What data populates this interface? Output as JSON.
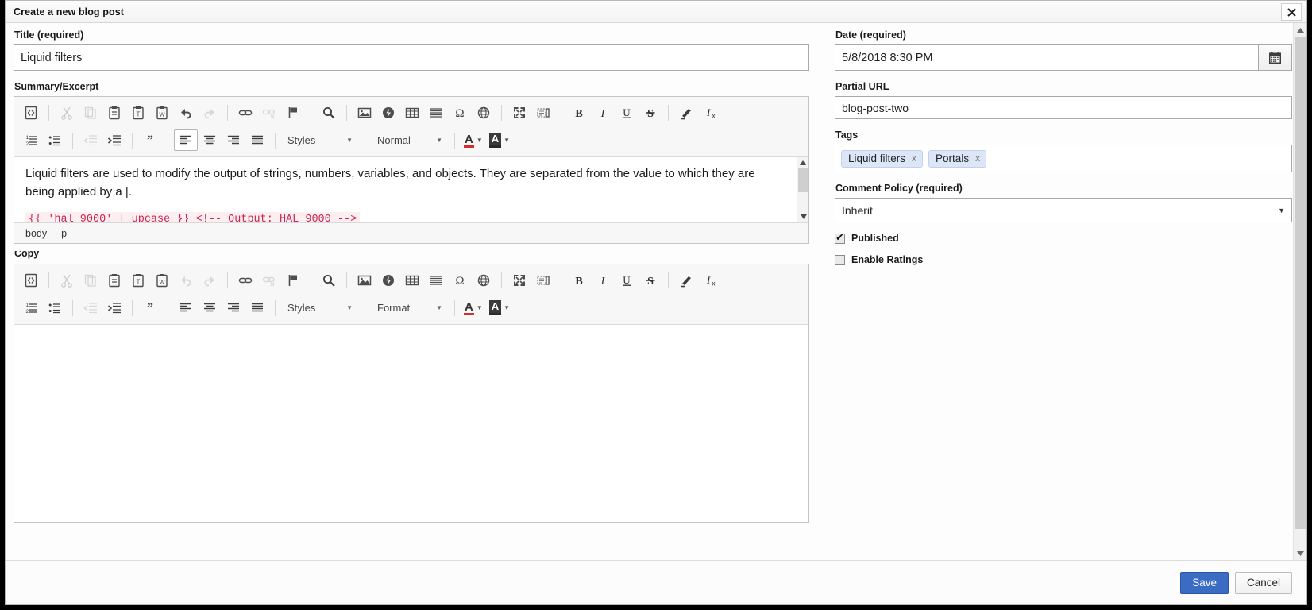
{
  "dialog": {
    "title": "Create a new blog post",
    "close_icon": "close-icon"
  },
  "left": {
    "title_label": "Title (required)",
    "title_value": "Liquid filters",
    "summary_label": "Summary/Excerpt",
    "summary_paragraph": "Liquid filters are used to modify the output of strings, numbers, variables, and objects. They are separated from the value to which they are being applied by a |.",
    "summary_code": "{{ 'hal 9000' | upcase }} <!-- Output: HAL 9000 -->",
    "summary_path": [
      "body",
      "p"
    ],
    "copy_label": "Copy"
  },
  "toolbar": {
    "styles_label": "Styles",
    "format_normal": "Normal",
    "format_label": "Format",
    "buttons": [
      {
        "name": "source-icon",
        "title": "Source"
      },
      {
        "name": "cut-icon",
        "title": "Cut"
      },
      {
        "name": "copy-icon",
        "title": "Copy"
      },
      {
        "name": "paste-icon",
        "title": "Paste"
      },
      {
        "name": "paste-as-text-icon",
        "title": "Paste as plain text"
      },
      {
        "name": "paste-from-word-icon",
        "title": "Paste from Word"
      },
      {
        "name": "undo-icon",
        "title": "Undo"
      },
      {
        "name": "redo-icon",
        "title": "Redo"
      },
      {
        "name": "link-icon",
        "title": "Link"
      },
      {
        "name": "unlink-icon",
        "title": "Unlink"
      },
      {
        "name": "anchor-flag-icon",
        "title": "Anchor"
      },
      {
        "name": "find-icon",
        "title": "Find"
      },
      {
        "name": "image-icon",
        "title": "Image"
      },
      {
        "name": "flash-icon",
        "title": "Flash"
      },
      {
        "name": "table-icon",
        "title": "Table"
      },
      {
        "name": "horizontal-rule-icon",
        "title": "Horizontal line"
      },
      {
        "name": "special-char-icon",
        "title": "Insert special character"
      },
      {
        "name": "iframe-globe-icon",
        "title": "IFrame"
      },
      {
        "name": "maximize-icon",
        "title": "Maximize"
      },
      {
        "name": "show-blocks-icon",
        "title": "Show blocks"
      },
      {
        "name": "bold-icon",
        "title": "Bold"
      },
      {
        "name": "italic-icon",
        "title": "Italic"
      },
      {
        "name": "underline-icon",
        "title": "Underline"
      },
      {
        "name": "strikethrough-icon",
        "title": "Strikethrough"
      },
      {
        "name": "remove-format-icon",
        "title": "Remove format"
      },
      {
        "name": "text-color-icon",
        "title": "Text color"
      }
    ],
    "row2_buttons": [
      {
        "name": "numbered-list-icon",
        "title": "Insert/Remove Numbered List"
      },
      {
        "name": "bulleted-list-icon",
        "title": "Insert/Remove Bulleted List"
      },
      {
        "name": "decrease-indent-icon",
        "title": "Decrease Indent"
      },
      {
        "name": "increase-indent-icon",
        "title": "Increase Indent"
      },
      {
        "name": "blockquote-icon",
        "title": "Block Quote"
      },
      {
        "name": "align-left-icon",
        "title": "Align Left"
      },
      {
        "name": "align-center-icon",
        "title": "Center"
      },
      {
        "name": "align-right-icon",
        "title": "Align Right"
      },
      {
        "name": "justify-icon",
        "title": "Justify"
      },
      {
        "name": "text-color-icon",
        "title": "Text Color"
      },
      {
        "name": "background-color-icon",
        "title": "Background Color"
      }
    ]
  },
  "right": {
    "date_label": "Date (required)",
    "date_value": "5/8/2018 8:30 PM",
    "calendar_icon": "calendar-icon",
    "url_label": "Partial URL",
    "url_value": "blog-post-two",
    "tags_label": "Tags",
    "tags": [
      "Liquid filters",
      "Portals"
    ],
    "tag_remove_label": "x",
    "comment_label": "Comment Policy (required)",
    "comment_value": "Inherit",
    "published_label": "Published",
    "published_checked": true,
    "ratings_label": "Enable Ratings",
    "ratings_checked": false
  },
  "footer": {
    "save_label": "Save",
    "cancel_label": "Cancel"
  },
  "colors": {
    "accent": "#3b6cc4",
    "code_text": "#c7254e",
    "code_bg": "#fdeef1",
    "chip_bg": "#dce6f7"
  }
}
